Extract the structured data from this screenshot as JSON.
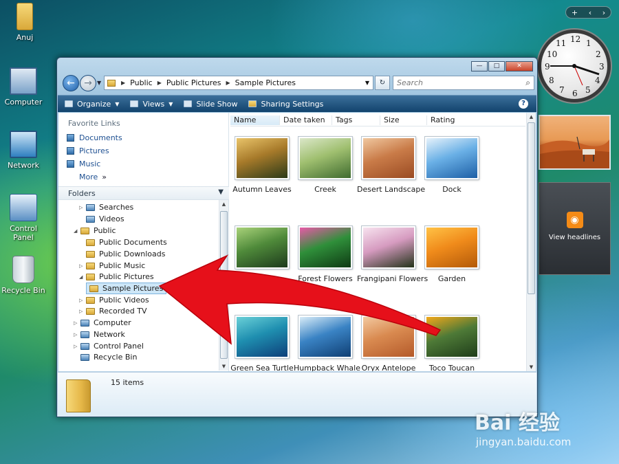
{
  "desktop": {
    "icons": [
      {
        "label": "Anuj"
      },
      {
        "label": "Computer"
      },
      {
        "label": "Network"
      },
      {
        "label": "Control Panel"
      },
      {
        "label": "Recycle Bin"
      }
    ]
  },
  "gadgets": {
    "controls": {
      "add": "+"
    },
    "clock": {
      "numerals": [
        "12",
        "1",
        "2",
        "3",
        "4",
        "5",
        "6",
        "7",
        "8",
        "9",
        "10",
        "11"
      ]
    },
    "feed": {
      "label": "View headlines"
    }
  },
  "window": {
    "buttons": {
      "minimize": "—",
      "maximize": "□",
      "close": "✕"
    },
    "address": {
      "crumbs": [
        "Public",
        "Public Pictures",
        "Sample Pictures"
      ]
    },
    "search": {
      "placeholder": "Search"
    },
    "toolbar": {
      "organize": "Organize",
      "views": "Views",
      "slideshow": "Slide Show",
      "sharing": "Sharing Settings",
      "help": "?"
    },
    "sidebar": {
      "favorites_title": "Favorite Links",
      "favorites": [
        "Documents",
        "Pictures",
        "Music"
      ],
      "more": "More",
      "more_glyph": "»",
      "folders_title": "Folders",
      "tree": [
        {
          "label": "Searches"
        },
        {
          "label": "Videos"
        },
        {
          "label": "Public"
        },
        {
          "label": "Public Documents"
        },
        {
          "label": "Public Downloads"
        },
        {
          "label": "Public Music"
        },
        {
          "label": "Public Pictures"
        },
        {
          "label": "Sample Pictures"
        },
        {
          "label": "Public Videos"
        },
        {
          "label": "Recorded TV"
        },
        {
          "label": "Computer"
        },
        {
          "label": "Network"
        },
        {
          "label": "Control Panel"
        },
        {
          "label": "Recycle Bin"
        }
      ]
    },
    "columns": [
      "Name",
      "Date taken",
      "Tags",
      "Size",
      "Rating"
    ],
    "files": [
      {
        "name": "Autumn Leaves",
        "colors": [
          "#2b3a18",
          "#a77a2a",
          "#e9c46a"
        ]
      },
      {
        "name": "Creek",
        "colors": [
          "#3f6b2f",
          "#9fbf6f",
          "#dbe7c9"
        ]
      },
      {
        "name": "Desert Landscape",
        "colors": [
          "#9a4b23",
          "#c97b48",
          "#f0c8a0"
        ]
      },
      {
        "name": "Dock",
        "colors": [
          "#1d5fa6",
          "#6ab0e6",
          "#e6f2fb"
        ]
      },
      {
        "name": "Forest",
        "colors": [
          "#1d3a1c",
          "#4f8a3a",
          "#a9d27a"
        ]
      },
      {
        "name": "Forest Flowers",
        "colors": [
          "#0f3a14",
          "#2f8f3a",
          "#e85aa8"
        ]
      },
      {
        "name": "Frangipani Flowers",
        "colors": [
          "#23331a",
          "#d69bc0",
          "#f7e3ef"
        ]
      },
      {
        "name": "Garden",
        "colors": [
          "#b35a09",
          "#f08b1b",
          "#ffc246"
        ]
      },
      {
        "name": "Green Sea Turtle",
        "colors": [
          "#0d3f7a",
          "#1f8fb0",
          "#6ad0d8"
        ]
      },
      {
        "name": "Humpback Whale",
        "colors": [
          "#0f3f74",
          "#3a83c4",
          "#d8ecf8"
        ]
      },
      {
        "name": "Oryx Antelope",
        "colors": [
          "#b45a2a",
          "#d98a50",
          "#f3c9a0"
        ]
      },
      {
        "name": "Toco Toucan",
        "colors": [
          "#1f3d1a",
          "#4e7a37",
          "#f2a81b"
        ]
      }
    ],
    "details": {
      "count": "15 items"
    }
  },
  "watermark": {
    "logo": "Bai 经验",
    "url": "jingyan.baidu.com"
  }
}
